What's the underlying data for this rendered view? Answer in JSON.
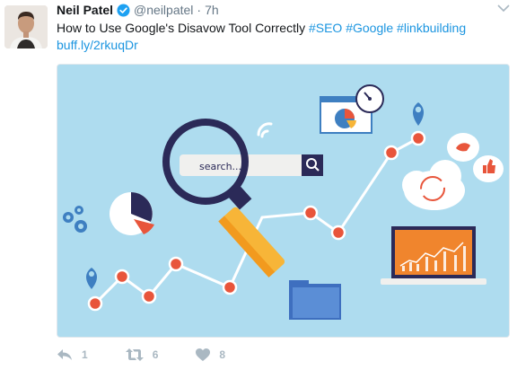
{
  "tweet": {
    "author_name": "Neil Patel",
    "handle": "@neilpatel",
    "separator": "·",
    "time": "7h",
    "text_intro": "How to Use Google's Disavow Tool Correctly ",
    "hashtags": [
      "#SEO",
      "#Google",
      "#linkbuilding"
    ],
    "link": "buff.ly/2rkuqDr"
  },
  "media": {
    "search_placeholder": "search...",
    "background_color": "#aedcef"
  },
  "actions": {
    "reply_icon": "reply-icon",
    "reply_count": "1",
    "retweet_icon": "retweet-icon",
    "retweet_count": "6",
    "like_icon": "heart-icon",
    "like_count": "8"
  },
  "colors": {
    "link": "#1b95e0",
    "verified": "#1da1f2",
    "muted": "#657786",
    "action": "#aab8c2"
  }
}
